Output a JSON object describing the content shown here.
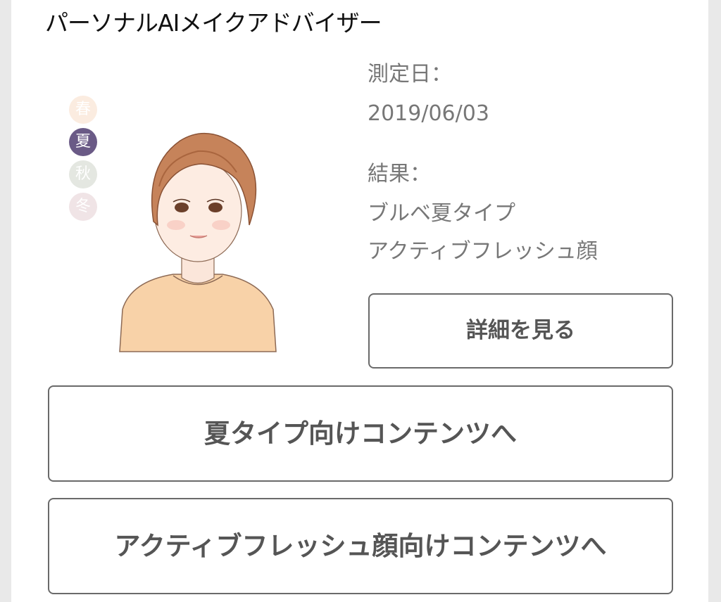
{
  "page_title": "パーソナルAIメイクアドバイザー",
  "seasons": [
    {
      "label": "春",
      "bg": "#fbece0",
      "fg": "#ffffff"
    },
    {
      "label": "夏",
      "bg": "#6a5a86",
      "fg": "#ffffff"
    },
    {
      "label": "秋",
      "bg": "#e4e7e1",
      "fg": "#ffffff"
    },
    {
      "label": "冬",
      "bg": "#f0e4e6",
      "fg": "#ffffff"
    }
  ],
  "selected_season": "夏",
  "measurement": {
    "date_label": "測定日：",
    "date_value": "2019/06/03",
    "result_label": "結果：",
    "result_type": "ブルベ夏タイプ",
    "result_face": "アクティブフレッシュ顔"
  },
  "buttons": {
    "detail": "詳細を見る",
    "summer_content": "夏タイプ向けコンテンツへ",
    "face_content": "アクティブフレッシュ顔向けコンテンツへ"
  },
  "colors": {
    "card_bg": "#ffffff",
    "page_bg": "#e9e9e9",
    "border": "#6a6a6a",
    "text_muted": "#777777",
    "hair": "#c27a4f",
    "skin": "#fbe8dc",
    "shirt": "#f7c99a"
  }
}
